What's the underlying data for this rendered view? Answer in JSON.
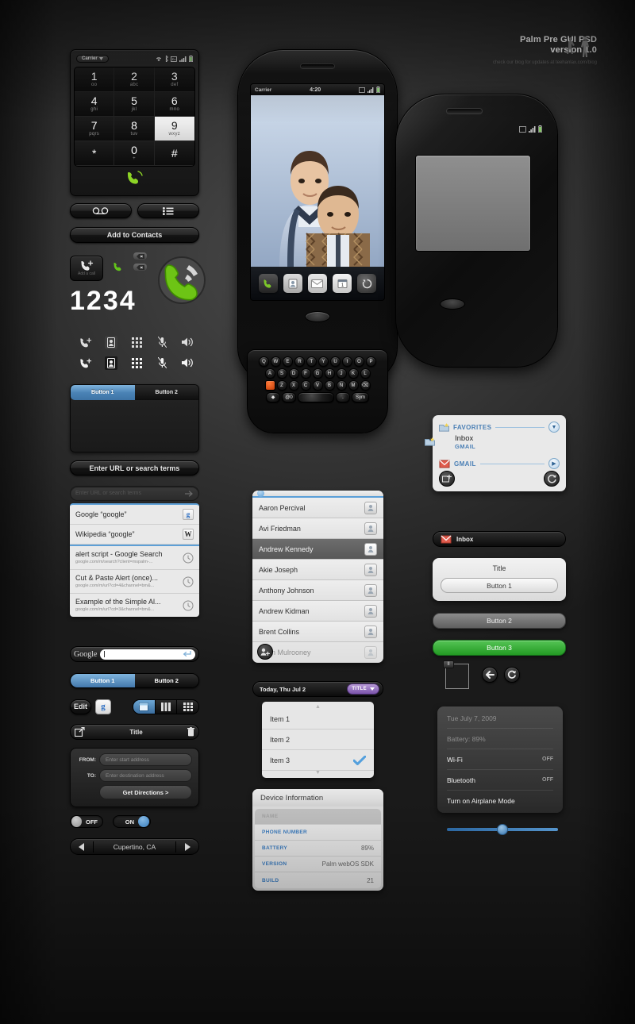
{
  "header": {
    "title_line1": "Palm Pre GUI PSD",
    "title_line2": "version 1.0",
    "subtitle": "check our blog for updates at teehanlax.com/blog"
  },
  "dialer": {
    "carrier": "Carrier",
    "keys": [
      {
        "num": "1",
        "sub": "oo"
      },
      {
        "num": "2",
        "sub": "abc"
      },
      {
        "num": "3",
        "sub": "def"
      },
      {
        "num": "4",
        "sub": "ghi"
      },
      {
        "num": "5",
        "sub": "jkl"
      },
      {
        "num": "6",
        "sub": "mno"
      },
      {
        "num": "7",
        "sub": "pqrs"
      },
      {
        "num": "8",
        "sub": "tuv"
      },
      {
        "num": "9",
        "sub": "wxyz"
      },
      {
        "num": "*",
        "sub": ""
      },
      {
        "num": "0",
        "sub": "+"
      },
      {
        "num": "#",
        "sub": ""
      }
    ],
    "active_key_index": 8,
    "dialed_digits": "1234",
    "add_call_label": "Add a call",
    "add_to_contacts": "Add to Contacts"
  },
  "tabs": {
    "tab1": "Button 1",
    "tab2": "Button 2"
  },
  "browser": {
    "url_button": "Enter URL or search terms",
    "url_placeholder": "Enter URL or search terms",
    "results": [
      {
        "title": "Google “google”",
        "sub": "",
        "badge": "g",
        "badge_kind": "google"
      },
      {
        "title": "Wikipedia “google”",
        "sub": "",
        "badge": "W",
        "badge_kind": "wiki"
      },
      {
        "title": "alert script - Google Search",
        "sub": "google.com/m/search?client=mspalm-...",
        "badge": "◔",
        "badge_kind": "clock"
      },
      {
        "title": "Cut & Paste Alert (once)...",
        "sub": "google.com/m/url?cd=4&channel=bm&...",
        "badge": "◔",
        "badge_kind": "clock"
      },
      {
        "title": "Example of the Simple Al...",
        "sub": "google.com/m/url?cd=3&channel=bm&...",
        "badge": "◔",
        "badge_kind": "clock"
      }
    ],
    "google_label": "Google"
  },
  "segmented": {
    "button1": "Button 1",
    "button2": "Button 2",
    "edit": "Edit",
    "google_icon": "g"
  },
  "title_toolbar": {
    "title": "Title"
  },
  "directions": {
    "from_label": "FROM:",
    "to_label": "TO:",
    "from_placeholder": "Enter start address",
    "to_placeholder": "Enter destination address",
    "submit": "Get Directions >"
  },
  "switches": {
    "off": "OFF",
    "on": "ON"
  },
  "stepper": {
    "value": "Cupertino, CA"
  },
  "phone1": {
    "carrier": "Carrier",
    "time": "4:20",
    "keyboard": {
      "row1": [
        "Q",
        "W",
        "E",
        "R",
        "T",
        "Y",
        "U",
        "I",
        "O",
        "P"
      ],
      "row2": [
        "A",
        "S",
        "D",
        "F",
        "G",
        "H",
        "J",
        "K",
        "L"
      ],
      "row3": [
        "Z",
        "X",
        "C",
        "V",
        "B",
        "N",
        "M"
      ],
      "sym": "Sym",
      "at": "@0"
    }
  },
  "contacts": {
    "items": [
      {
        "name": "Aaron Percival",
        "selected": false,
        "faded": false
      },
      {
        "name": "Avi Friedman",
        "selected": false,
        "faded": false
      },
      {
        "name": "Andrew Kennedy",
        "selected": true,
        "faded": false
      },
      {
        "name": "Akie Joseph",
        "selected": false,
        "faded": false
      },
      {
        "name": "Anthony Johnson",
        "selected": false,
        "faded": false
      },
      {
        "name": "Andrew Kidman",
        "selected": false,
        "faded": false
      },
      {
        "name": "Brent Collins",
        "selected": false,
        "faded": false
      },
      {
        "name": "Brian Mulrooney",
        "selected": false,
        "faded": true
      }
    ]
  },
  "today": {
    "date": "Today, Thu Jul 2",
    "title_pill": "TITLE",
    "items": [
      {
        "label": "Item 1",
        "checked": false
      },
      {
        "label": "Item 2",
        "checked": false
      },
      {
        "label": "Item 3",
        "checked": true
      }
    ]
  },
  "device_info": {
    "header": "Device Information",
    "rows": [
      {
        "key": "NAME",
        "value": ""
      },
      {
        "key": "PHONE NUMBER",
        "value": ""
      },
      {
        "key": "BATTERY",
        "value": "89%"
      },
      {
        "key": "VERSION",
        "value": "Palm webOS SDK"
      },
      {
        "key": "BUILD",
        "value": "21"
      }
    ]
  },
  "mail": {
    "favorites": "FAVORITES",
    "inbox": "Inbox",
    "inbox_account": "GMAIL",
    "gmail": "GMAIL",
    "inbox_bar": "Inbox"
  },
  "dialog": {
    "title": "Title",
    "button1": "Button 1",
    "button2": "Button 2",
    "button3": "Button 3",
    "pause_badge": "II"
  },
  "settings": {
    "rows": [
      {
        "label": "Tue July 7, 2009",
        "value": "",
        "dim": true
      },
      {
        "label": "Battery: 89%",
        "value": "",
        "dim": true
      },
      {
        "label": "Wi-Fi",
        "value": "OFF",
        "dim": false
      },
      {
        "label": "Bluetooth",
        "value": "OFF",
        "dim": false
      },
      {
        "label": "Turn on Airplane Mode",
        "value": "",
        "dim": false
      }
    ]
  },
  "colors": {
    "accent_blue": "#4a82b5",
    "green": "#239a23",
    "purple": "#7a53ab",
    "link_blue": "#3d7fc4"
  }
}
